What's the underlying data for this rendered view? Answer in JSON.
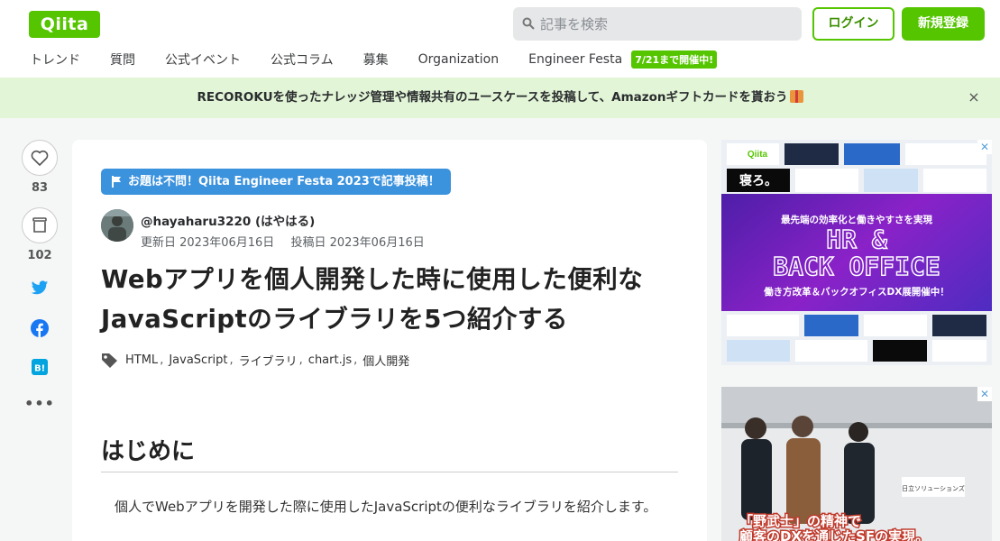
{
  "header": {
    "logo": "Qiita",
    "search_placeholder": "記事を検索",
    "login_label": "ログイン",
    "signup_label": "新規登録",
    "nav": [
      "トレンド",
      "質問",
      "公式イベント",
      "公式コラム",
      "募集",
      "Organization",
      "Engineer Festa"
    ],
    "festa_badge": "7/21まで開催中!"
  },
  "banner": {
    "text": "RECOROKUを使ったナレッジ管理や情報共有のユースケースを投稿して、Amazonギフトカードを貰おう",
    "close": "×"
  },
  "sidebar": {
    "like_count": "83",
    "stock_count": "102"
  },
  "article": {
    "festa_label": "お題は不問！Qiita Engineer Festa 2023で記事投稿！",
    "author": "@hayaharu3220 (はやはる)",
    "updated": "更新日 2023年06月16日",
    "posted": "投稿日 2023年06月16日",
    "title": "Webアプリを個人開発した時に使用した便利なJavaScriptのライブラリを5つ紹介する",
    "tags": [
      "HTML",
      "JavaScript",
      "ライブラリ",
      "chart.js",
      "個人開発"
    ],
    "heading": "はじめに",
    "intro": "個人でWebアプリを開発した際に使用したJavaScriptの便利なライブラリを紹介します。"
  },
  "ads": {
    "ad1": {
      "logo": "Qiita",
      "tagline": "最先端の効率化と働きやすさを実現",
      "headline1": "HR &",
      "headline2": "BACK OFFICE",
      "sub": "働き方改革＆バックオフィスDX展開催中！",
      "small": "寝ろ。"
    },
    "ad2": {
      "sign": "日立ソリューションズ",
      "caption1": "「野武士」の精神で",
      "caption2": "顧客のDXを通じたSFの実現。"
    },
    "close": "✕"
  },
  "colors": {
    "brand": "#55c500",
    "banner_bg": "#e2f5d7",
    "festa_blue": "#3b92dd",
    "twitter": "#1da1f2",
    "facebook": "#1877f2",
    "hatena": "#00a4de"
  }
}
